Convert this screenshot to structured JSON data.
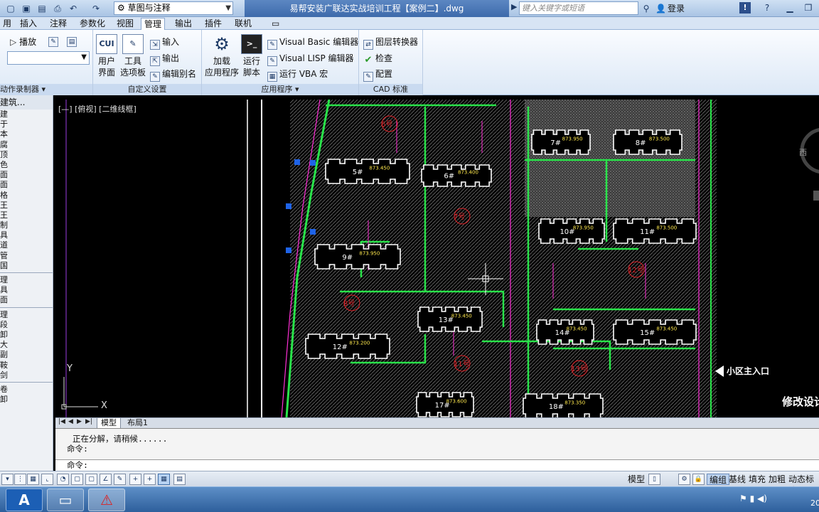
{
  "titlebar": {
    "workspace": "草图与注释",
    "document_title": "易帮安装广联达实战培训工程【案例二】.dwg",
    "search_placeholder": "键入关键字或短语",
    "login": "登录",
    "quick_access_icons": [
      "new-icon",
      "save-icon",
      "save-as-icon",
      "print-icon",
      "undo-icon",
      "redo-icon"
    ]
  },
  "menu": {
    "tabs": [
      "用",
      "插入",
      "注释",
      "参数化",
      "视图",
      "管理",
      "输出",
      "插件",
      "联机"
    ],
    "active_tab": "管理"
  },
  "ribbon": {
    "play": "播放",
    "action_recorder": "动作录制器",
    "cui_icon": "CUI",
    "user_interface": [
      "用户",
      "界面"
    ],
    "tool_palettes": [
      "工具",
      "选项板"
    ],
    "import": "输入",
    "export": "输出",
    "edit_aliases": "编辑别名",
    "customize_panel": "自定义设置",
    "load_application": [
      "加载",
      "应用程序"
    ],
    "run_script": [
      "运行",
      "脚本"
    ],
    "vba_editor": "Visual Basic 编辑器",
    "lisp_editor": "Visual LISP 编辑器",
    "run_vba": "运行 VBA 宏",
    "applications_panel": "应用程序",
    "layer_translator": "图层转换器",
    "check": "检查",
    "configure": "配置",
    "cad_standards_panel": "CAD 标准"
  },
  "left_palette": {
    "header": "建筑...",
    "rows_a": [
      "建",
      "于",
      "本",
      "腐",
      "顶",
      "色",
      "面",
      "面",
      "格",
      "王",
      "王",
      "制",
      "具",
      "道",
      "管",
      "国"
    ],
    "rows_b": [
      "理",
      "具",
      "面"
    ],
    "rows_c": [
      "理",
      "段",
      "卸",
      "大",
      "副",
      "鞍",
      "剑"
    ],
    "rows_d": [
      "卷",
      "卸"
    ]
  },
  "viewport": {
    "label": "[—] [俯视] [二维线框]",
    "ucs_y": "Y",
    "ucs_x": "X",
    "buildings": [
      "5#",
      "6#",
      "7#",
      "8#",
      "9#",
      "10#",
      "11#",
      "12#",
      "13#",
      "14#",
      "15#",
      "17#",
      "18#"
    ],
    "elevations": [
      "873.450",
      "873.400",
      "873.950",
      "873.500",
      "873.950",
      "873.950",
      "873.500",
      "873.200",
      "873.450",
      "873.450",
      "873.450",
      "873.600",
      "873.350"
    ],
    "zones": [
      "6号",
      "7号",
      "8号",
      "11号",
      "12号",
      "13号"
    ],
    "entrance": "小区主入口",
    "revision_note": "修改设计"
  },
  "layout_tabs": {
    "tabs": [
      "模型",
      "布局1"
    ],
    "active": "模型"
  },
  "command": {
    "line1": "正在分解，请稍候......",
    "line2": "命令:",
    "prompt": "命令:"
  },
  "status": {
    "model": "模型",
    "right_toggles": [
      "编组",
      "基线",
      "填充",
      "加粗",
      "动态标注"
    ]
  },
  "taskbar": {
    "start_letter": "A",
    "clock": "20"
  },
  "colors": {
    "road": "#29e34a",
    "boundary": "#ff2fd6",
    "hatch": "#8a8a8a",
    "building": "#ffffff",
    "zone": "#e2242a"
  }
}
